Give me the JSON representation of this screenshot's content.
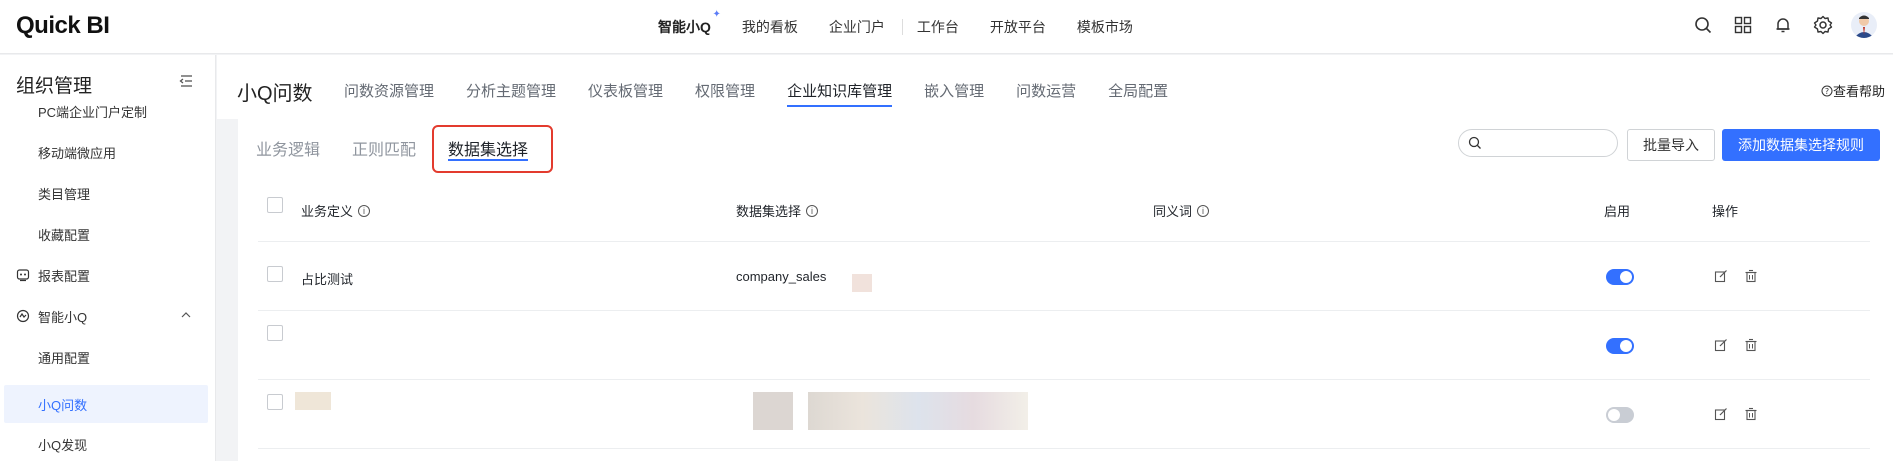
{
  "app": {
    "logo": "Quick BI"
  },
  "topnav": {
    "items": [
      "智能小Q",
      "我的看板",
      "企业门户",
      "工作台",
      "开放平台",
      "模板市场"
    ]
  },
  "sidebar": {
    "title": "组织管理",
    "items": [
      {
        "label": "PC端企业门户定制",
        "kind": "sub"
      },
      {
        "label": "移动端微应用",
        "kind": "sub"
      },
      {
        "label": "类目管理",
        "kind": "sub"
      },
      {
        "label": "收藏配置",
        "kind": "sub"
      },
      {
        "label": "报表配置",
        "kind": "group"
      },
      {
        "label": "智能小Q",
        "kind": "group"
      },
      {
        "label": "通用配置",
        "kind": "sub"
      },
      {
        "label": "小Q问数",
        "kind": "sub",
        "active": true
      },
      {
        "label": "小Q发现",
        "kind": "sub"
      }
    ]
  },
  "header": {
    "title": "小Q问数",
    "tabs": [
      "问数资源管理",
      "分析主题管理",
      "仪表板管理",
      "权限管理",
      "企业知识库管理",
      "嵌入管理",
      "问数运营",
      "全局配置"
    ],
    "active_tab": "企业知识库管理",
    "help": "查看帮助"
  },
  "subtabs": {
    "items": [
      "业务逻辑",
      "正则匹配",
      "数据集选择"
    ],
    "active": "数据集选择"
  },
  "toolbar": {
    "search_placeholder": "",
    "import_label": "批量导入",
    "add_label": "添加数据集选择规则"
  },
  "table": {
    "headers": {
      "definition": "业务定义",
      "dataset": "数据集选择",
      "synonym": "同义词",
      "enabled": "启用",
      "actions": "操作"
    },
    "rows": [
      {
        "definition": "占比测试",
        "dataset": "company_sales",
        "synonym": "",
        "enabled": true
      },
      {
        "definition": "",
        "dataset": "",
        "synonym": "",
        "enabled": true
      },
      {
        "definition": "",
        "dataset": "",
        "synonym": "",
        "enabled": false
      }
    ]
  },
  "colors": {
    "accent": "#3370ff",
    "highlight": "#e33b2e"
  }
}
